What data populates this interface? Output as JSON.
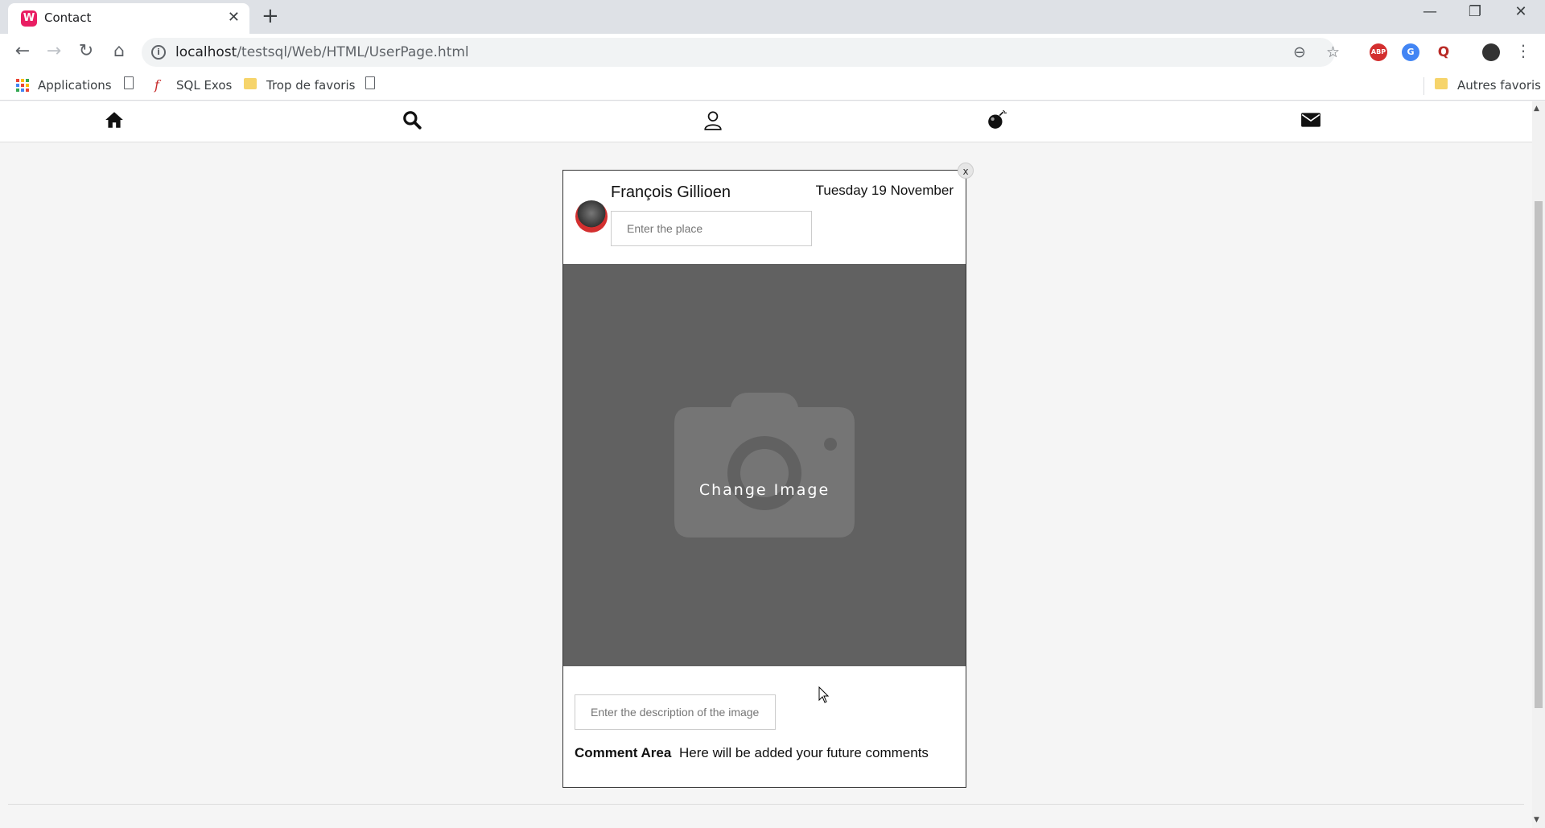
{
  "browser": {
    "tab_title": "Contact",
    "tab_favicon": "W",
    "url_host": "localhost",
    "url_path": "/testsql/Web/HTML/UserPage.html",
    "extensions": [
      {
        "name": "adblock-icon",
        "label": "ABP",
        "color": "#d32f2f"
      },
      {
        "name": "translate-icon",
        "label": "G",
        "color": "#4285f4"
      },
      {
        "name": "quora-icon",
        "label": "Q",
        "color": "#b92b27"
      }
    ],
    "bookmarks": {
      "apps": "Applications",
      "sql": "SQL Exos",
      "favorites": "Trop de favoris",
      "other": "Autres favoris"
    }
  },
  "site_nav": {
    "icons": [
      "home-icon",
      "search-icon",
      "user-icon",
      "bomb-icon",
      "mail-icon"
    ]
  },
  "post": {
    "user_name": "François Gillioen",
    "date": "Tuesday 19 November",
    "place_placeholder": "Enter the place",
    "change_image_label": "Change Image",
    "description_placeholder": "Enter the description of the image",
    "comment_title": "Comment Area",
    "comment_text": "Here will be added your future comments",
    "close_label": "x"
  },
  "colors": {
    "image_area": "#616161",
    "page_bg": "#f5f5f5",
    "avatar_ring": "#d32f2f"
  }
}
